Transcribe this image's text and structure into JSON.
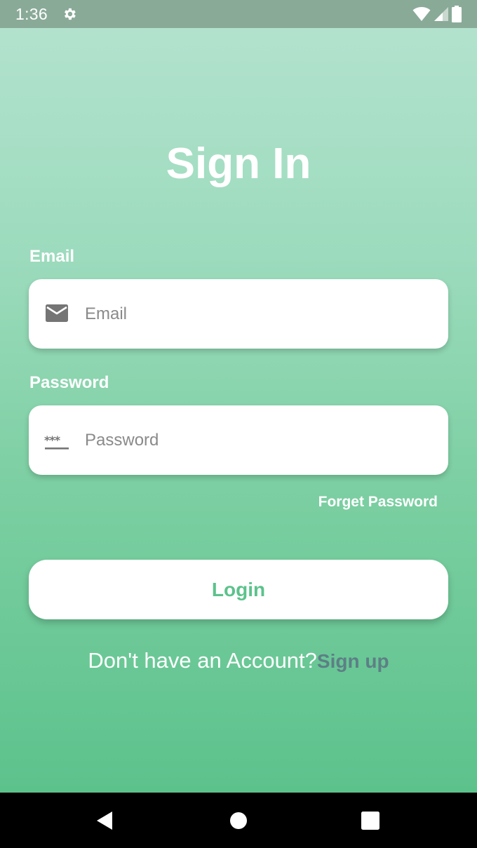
{
  "status_bar": {
    "time": "1:36",
    "icons": [
      "gear-icon",
      "wifi-icon",
      "signal-icon",
      "battery-icon"
    ]
  },
  "page": {
    "title": "Sign In"
  },
  "email": {
    "label": "Email",
    "placeholder": "Email",
    "value": "",
    "icon": "mail-icon"
  },
  "password": {
    "label": "Password",
    "placeholder": "Password",
    "value": "",
    "icon": "password-icon"
  },
  "forgot_password": "Forget Password",
  "login_button": "Login",
  "signup": {
    "prompt": "Don't have an Account?",
    "link": "Sign up"
  },
  "nav": {
    "icons": [
      "back-icon",
      "home-icon",
      "recents-icon"
    ]
  },
  "colors": {
    "gradient_top": "#b2e2cd",
    "gradient_bottom": "#5cc28c",
    "accent": "#5cc28c",
    "signup_link": "#5d7f86",
    "status_bar": "#8aaa98"
  }
}
